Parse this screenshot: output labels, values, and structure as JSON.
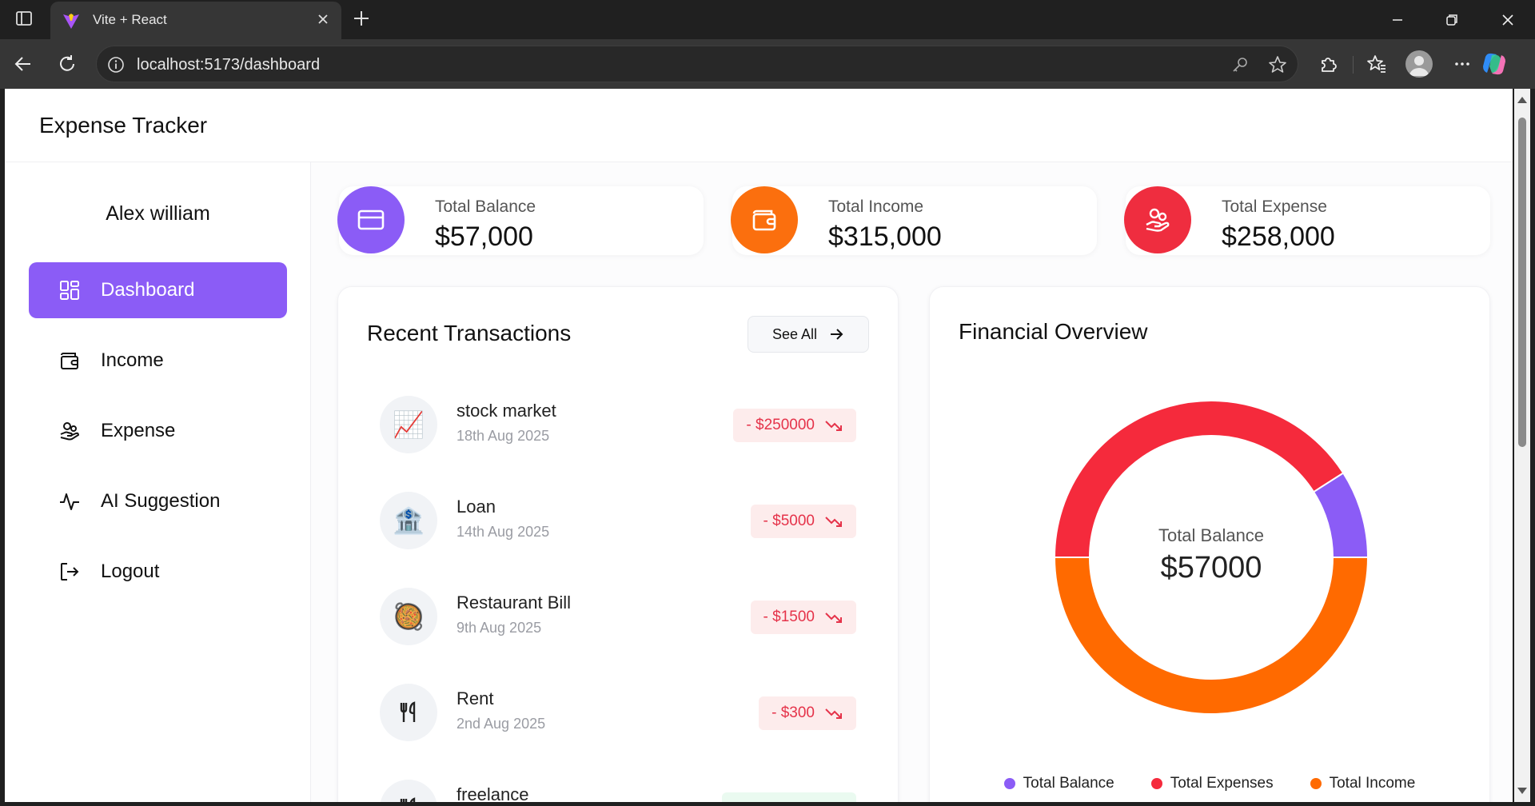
{
  "browser": {
    "tab_title": "Vite + React",
    "url": "localhost:5173/dashboard"
  },
  "app": {
    "title": "Expense Tracker"
  },
  "sidebar": {
    "user_name": "Alex william",
    "items": [
      {
        "label": "Dashboard",
        "icon": "dashboard-grid-icon",
        "active": true
      },
      {
        "label": "Income",
        "icon": "wallet-icon",
        "active": false
      },
      {
        "label": "Expense",
        "icon": "hand-coins-icon",
        "active": false
      },
      {
        "label": "AI Suggestion",
        "icon": "activity-pulse-icon",
        "active": false
      },
      {
        "label": "Logout",
        "icon": "logout-icon",
        "active": false
      }
    ]
  },
  "stats": [
    {
      "label": "Total Balance",
      "value": "$57,000",
      "icon": "credit-card-icon",
      "color": "#8b5cf6"
    },
    {
      "label": "Total Income",
      "value": "$315,000",
      "icon": "wallet-icon",
      "color": "#fb6f0e"
    },
    {
      "label": "Total Expense",
      "value": "$258,000",
      "icon": "hand-coins-icon",
      "color": "#ef2d3f"
    }
  ],
  "recent": {
    "title": "Recent Transactions",
    "see_all": "See All",
    "transactions": [
      {
        "name": "stock market",
        "date": "18th Aug 2025",
        "amount": "- $250000",
        "icon": "📈",
        "type": "expense"
      },
      {
        "name": "Loan",
        "date": "14th Aug 2025",
        "amount": "- $5000",
        "icon": "🏦",
        "type": "expense"
      },
      {
        "name": "Restaurant Bill",
        "date": "9th Aug 2025",
        "amount": "- $1500",
        "icon": "🥘",
        "type": "expense"
      },
      {
        "name": "Rent",
        "date": "2nd Aug 2025",
        "amount": "- $300",
        "icon": "🍴",
        "type": "expense"
      },
      {
        "name": "freelance",
        "date": "",
        "amount": "",
        "icon": "🍴",
        "type": "income"
      }
    ]
  },
  "overview": {
    "title": "Financial Overview",
    "center_label": "Total Balance",
    "center_value": "$57000",
    "legend": [
      {
        "label": "Total Balance",
        "color": "#8b5cf6"
      },
      {
        "label": "Total Expenses",
        "color": "#f52a3c"
      },
      {
        "label": "Total Income",
        "color": "#ff6a00"
      }
    ]
  },
  "chart_data": {
    "type": "pie",
    "categories": [
      "Total Balance",
      "Total Expenses",
      "Total Income"
    ],
    "values": [
      57000,
      258000,
      315000
    ],
    "colors": [
      "#8b5cf6",
      "#f52a3c",
      "#ff6a00"
    ],
    "title": "Financial Overview",
    "legend": "bottom"
  }
}
